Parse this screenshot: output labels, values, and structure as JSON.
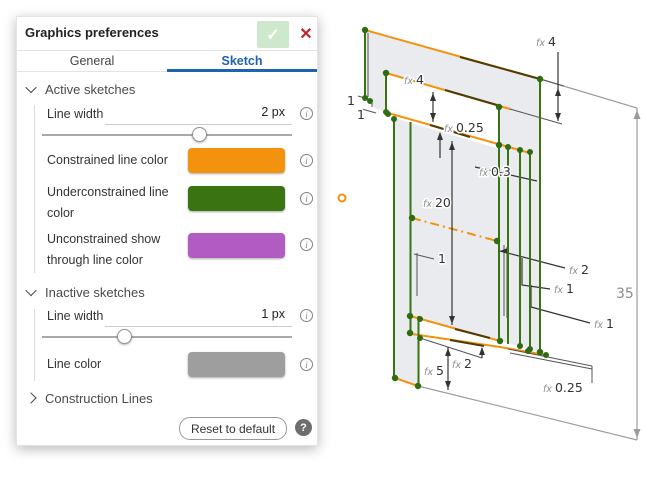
{
  "colors": {
    "constrained": "#f2920e",
    "underconstrained": "#3a7312",
    "unconstrained_show_through": "#b25bc2",
    "inactive": "#9e9e9e",
    "accent": "#1e63ad",
    "confirm_bg": "#cde8cd",
    "close": "#b8272e"
  },
  "dialog": {
    "title": "Graphics preferences",
    "confirm_icon": "✓",
    "close_icon": "✕",
    "tabs": [
      "General",
      "Sketch"
    ],
    "active_tab": "Sketch",
    "sections": [
      {
        "label": "Active sketches",
        "expanded": true
      },
      {
        "label": "Inactive sketches",
        "expanded": true
      },
      {
        "label": "Construction Lines",
        "expanded": false
      }
    ],
    "active_rows": {
      "line_width": {
        "label": "Line width",
        "value": "2 px"
      },
      "constrained": {
        "label": "Constrained line color"
      },
      "underconstrained": {
        "label": "Underconstrained line color"
      },
      "unconstrained": {
        "label": "Unconstrained show through line color"
      }
    },
    "inactive_rows": {
      "line_width": {
        "label": "Line width",
        "value": "1 px"
      },
      "line_color": {
        "label": "Line color"
      }
    },
    "reset_button": "Reset to default",
    "help_icon": "?",
    "info_icon": "i"
  },
  "sketch": {
    "dims": [
      {
        "prefix": "",
        "value": "1"
      },
      {
        "prefix": "",
        "value": "1"
      },
      {
        "prefix": "fx",
        "value": "4"
      },
      {
        "prefix": "fx",
        "value": "0.25"
      },
      {
        "prefix": "fx",
        "value": "4"
      },
      {
        "prefix": "fx",
        "value": "0.3"
      },
      {
        "prefix": "fx",
        "value": "20"
      },
      {
        "prefix": "",
        "value": "1"
      },
      {
        "prefix": "fx",
        "value": "2"
      },
      {
        "prefix": "fx",
        "value": "1"
      },
      {
        "prefix": "fx",
        "value": "1"
      },
      {
        "prefix": "",
        "value": "35"
      },
      {
        "prefix": "fx",
        "value": "5"
      },
      {
        "prefix": "fx",
        "value": "2"
      },
      {
        "prefix": "fx",
        "value": "0.25"
      }
    ]
  }
}
